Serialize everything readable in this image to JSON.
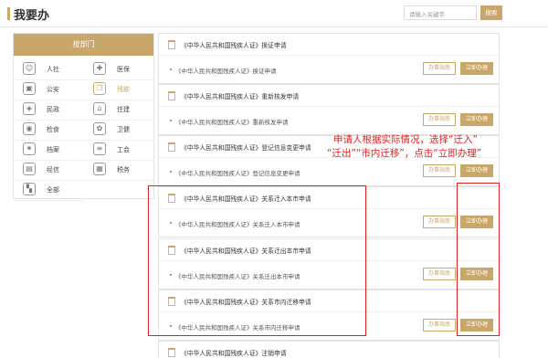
{
  "header": {
    "title": "我要办",
    "search_placeholder": "请输入关键字",
    "search_button": "搜索"
  },
  "sidebar": {
    "heading": "按部门",
    "depts": [
      {
        "label": "人社",
        "icon": "person-icon",
        "glyph": "☺"
      },
      {
        "label": "医保",
        "icon": "medical-icon",
        "glyph": "✚"
      },
      {
        "label": "公安",
        "icon": "id-card-icon",
        "glyph": "▣"
      },
      {
        "label": "残联",
        "icon": "book-icon",
        "glyph": "❐"
      },
      {
        "label": "民政",
        "icon": "shield-icon",
        "glyph": "◈"
      },
      {
        "label": "住建",
        "icon": "house-icon",
        "glyph": "⌂"
      },
      {
        "label": "检食",
        "icon": "check-icon",
        "glyph": "◉"
      },
      {
        "label": "卫健",
        "icon": "health-icon",
        "glyph": "✿"
      },
      {
        "label": "档案",
        "icon": "gear-icon",
        "glyph": "✷"
      },
      {
        "label": "工会",
        "icon": "database-icon",
        "glyph": "≡"
      },
      {
        "label": "经信",
        "icon": "clipboard-icon",
        "glyph": "▤"
      },
      {
        "label": "税务",
        "icon": "tax-icon",
        "glyph": "▦"
      },
      {
        "label": "全部",
        "icon": "grid-icon",
        "glyph": "▚"
      }
    ],
    "active_index": 3
  },
  "cards": [
    {
      "title": "《中华人民共和国残疾人证》换证申请",
      "item": "《中华人民共和国残疾人证》换证申请"
    },
    {
      "title": "《中华人民共和国残疾人证》重新核发申请",
      "item": "《中华人民共和国残疾人证》重新核发申请"
    },
    {
      "title": "《中华人民共和国残疾人证》登记信息变更申请",
      "item": "《中华人民共和国残疾人证》登记信息变更申请"
    },
    {
      "title": "《中华人民共和国残疾人证》关系迁入本市申请",
      "item": "《中华人民共和国残疾人证》关系迁入本市申请"
    },
    {
      "title": "《中华人民共和国残疾人证》关系迁出本市申请",
      "item": "《中华人民共和国残疾人证》关系迁出本市申请"
    },
    {
      "title": "《中华人民共和国残疾人证》关系市内迁移申请",
      "item": "《中华人民共和国残疾人证》关系市内迁移申请"
    },
    {
      "title": "《中华人民共和国残疾人证》注销申请",
      "item": ""
    }
  ],
  "buttons": {
    "guide": "办事指南",
    "apply": "立即办理"
  },
  "annotation": {
    "line1": "申请人根据实际情况，选择“迁入”",
    "line2": "“迁出”“市内迁移”，点击“立即办理”"
  },
  "colors": {
    "accent": "#c9a66a",
    "annotation": "#e02020"
  }
}
